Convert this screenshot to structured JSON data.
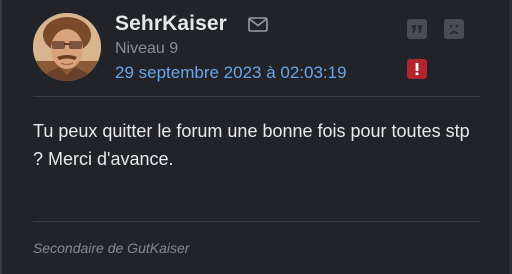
{
  "post": {
    "username": "SehrKaiser",
    "level": "Niveau 9",
    "date": "29 septembre 2023 à 02:03:19",
    "message": "Tu peux quitter le forum une bonne fois pour toutes stp ? Merci d'avance.",
    "signature": "Secondaire de GutKaiser"
  },
  "icons": {
    "mail": "envelope-icon",
    "quote": "quote-icon",
    "sad": "sad-face-icon",
    "report": "exclamation-icon"
  },
  "colors": {
    "background": "#212329",
    "link": "#6aa6e8",
    "report": "#b3242c"
  }
}
